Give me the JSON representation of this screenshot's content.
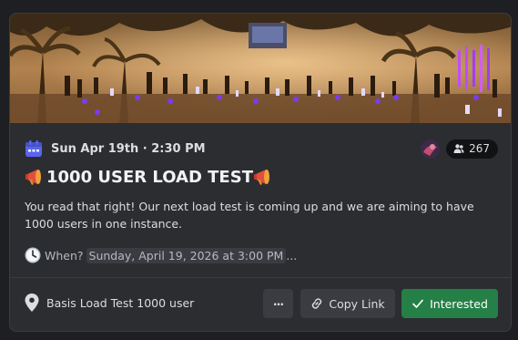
{
  "event": {
    "date": "Sun Apr 19th · 2:30 PM",
    "interested_count": "267",
    "title": "1000 USER LOAD TEST",
    "description": "You read that right! Our next load test is coming up and we are aiming to have 1000 users in one instance.",
    "when_label": "When?",
    "when_value": "Sunday, April 19, 2026 at 3:00 PM",
    "when_trailing": " ...",
    "location": "Basis Load Test 1000 user"
  },
  "actions": {
    "more_label": "···",
    "copy_link_label": "Copy Link",
    "interested_label": "Interested"
  },
  "colors": {
    "card_bg": "#2b2d31",
    "calendar_icon": "#5865f2",
    "interested_green": "#248046"
  },
  "icons": {
    "calendar": "calendar-icon",
    "megaphone": "megaphone-emoji",
    "clock": "clock-emoji",
    "location": "location-pin-icon",
    "link": "link-icon",
    "check": "checkmark-icon",
    "people": "people-icon"
  }
}
